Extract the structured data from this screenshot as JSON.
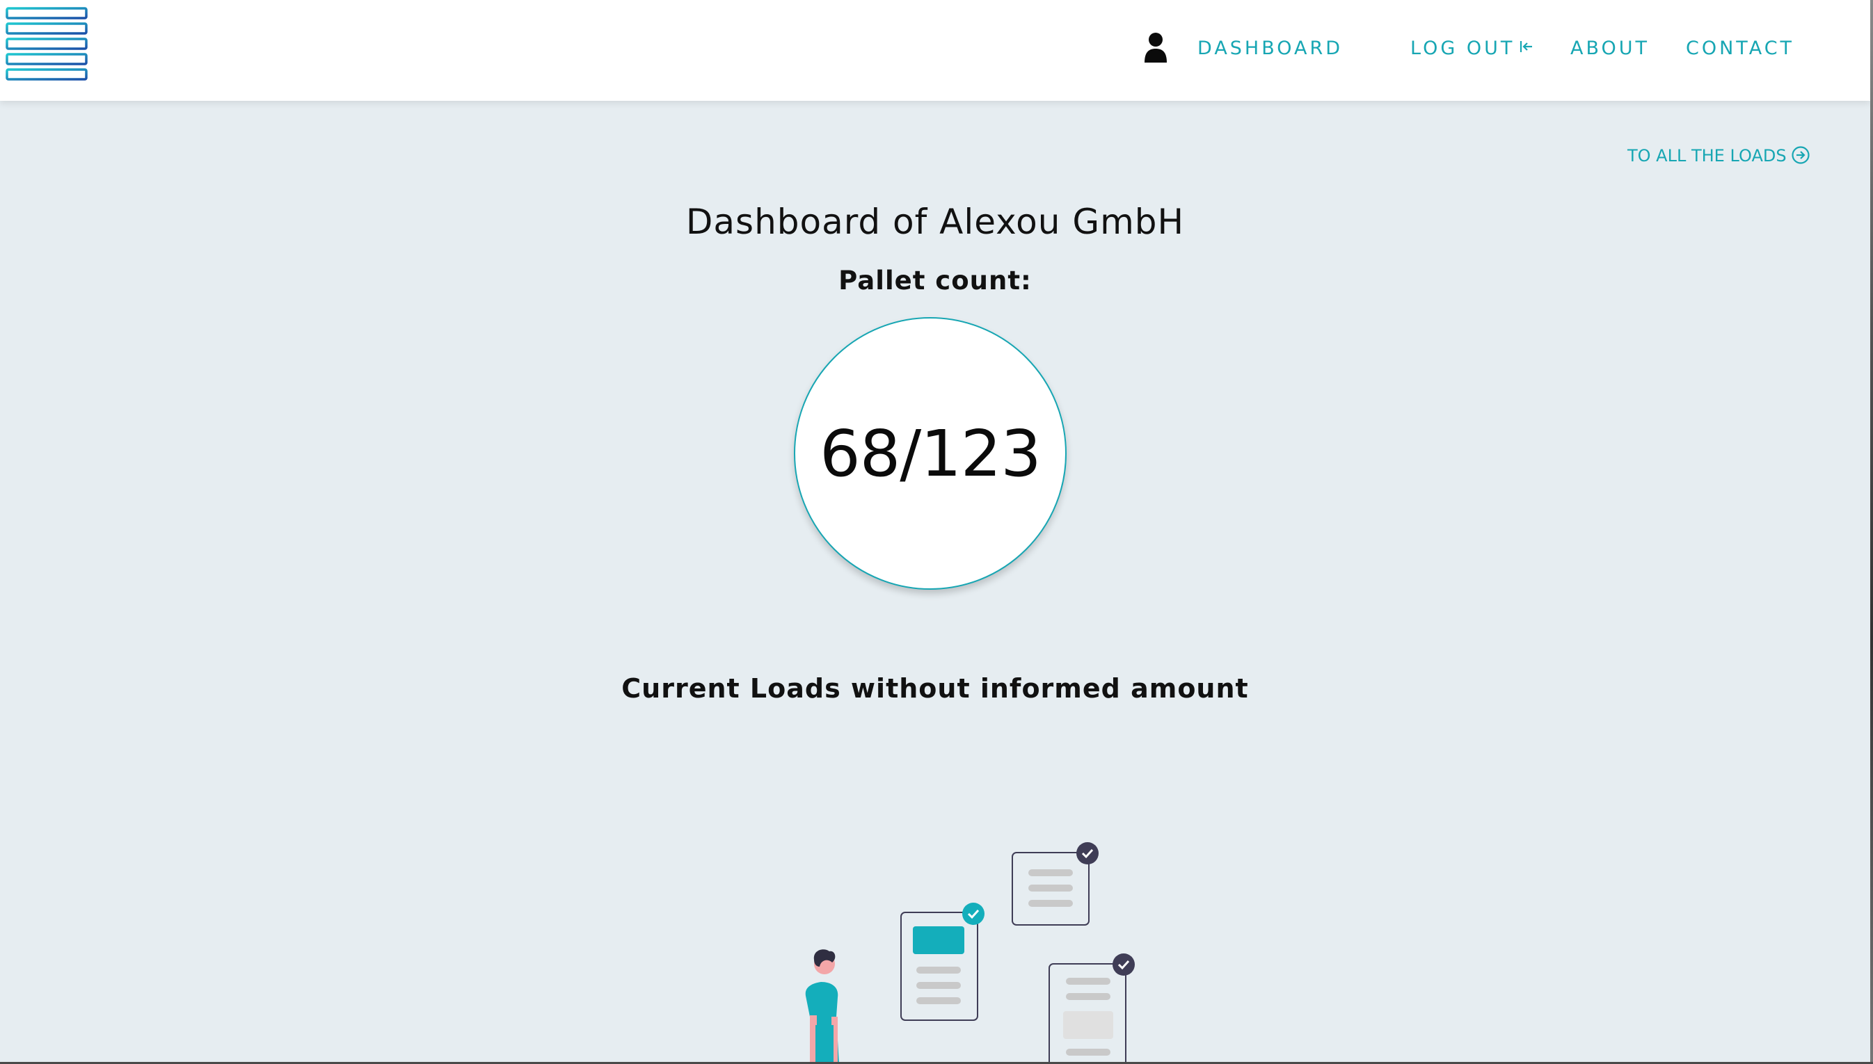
{
  "colors": {
    "accent": "#17a6b3",
    "background": "#e6edf1",
    "navbar": "#ffffff",
    "text": "#111111"
  },
  "navbar": {
    "logo": "pallet-stack-logo",
    "user_icon": "user-icon",
    "items": [
      {
        "label": "DASHBOARD"
      },
      {
        "label": "LOG OUT",
        "icon": "logout-icon"
      },
      {
        "label": "ABOUT"
      },
      {
        "label": "CONTACT"
      }
    ]
  },
  "main": {
    "all_loads_link": {
      "label": "TO ALL THE LOADS",
      "icon": "arrow-right-circle-icon"
    },
    "title": "Dashboard of Alexou GmbH",
    "pallet_count_label": "Pallet count:",
    "pallet_count_value": "68/123",
    "section_title": "Current Loads without informed amount",
    "illustration": "empty-state-documents-illustration"
  }
}
